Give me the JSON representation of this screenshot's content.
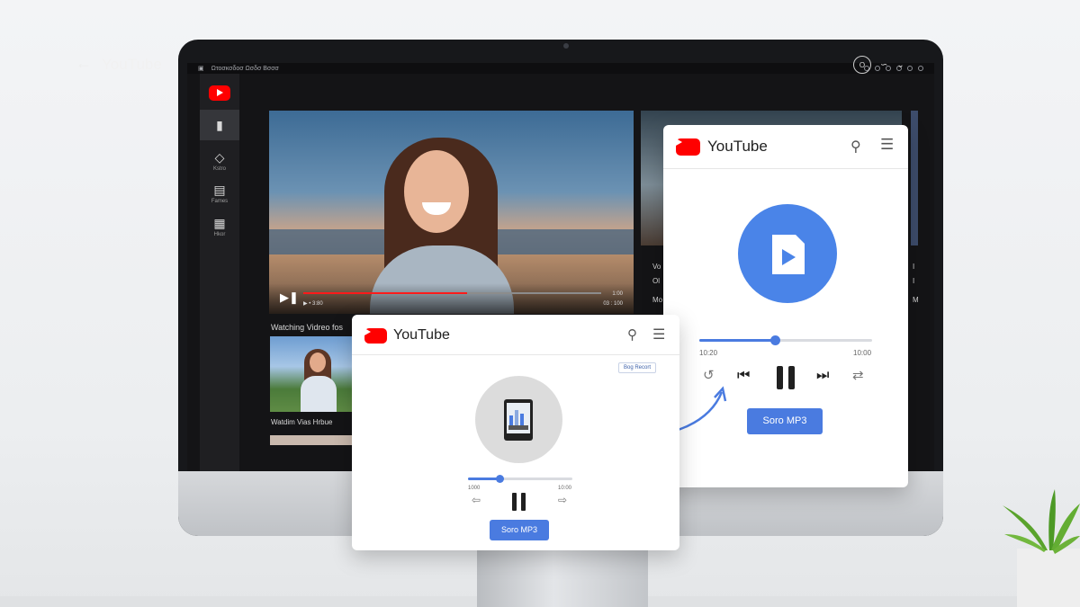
{
  "window": {
    "mac_bar_text": "Ωτοσκσδοσ Ωσδσ Βσσσ"
  },
  "sidebar": {
    "items": [
      {
        "icon": "youtube-logo-icon",
        "label": ""
      },
      {
        "icon": "file-icon",
        "label": ""
      },
      {
        "icon": "diamond-icon",
        "label": "Kstro"
      },
      {
        "icon": "clapper-icon",
        "label": "Fames"
      },
      {
        "icon": "music-file-icon",
        "label": "Hkor"
      }
    ]
  },
  "header": {
    "back_icon": "back-arrow-icon",
    "title": "YouTube",
    "account_text": "O"
  },
  "hero": {
    "time_left": "▶ • 3:80",
    "time_right_top": "1:00",
    "time_right_bottom": "03 : 100",
    "progress": 0.55
  },
  "side_column": {
    "labels": [
      "Vo",
      "Ol",
      "Mo"
    ]
  },
  "right_edge": {
    "labels": [
      "I",
      "I",
      "M"
    ]
  },
  "list": {
    "title": "Watching Vidreo fos",
    "caption": "Watdim Vias Hrbue"
  },
  "popup_small": {
    "brand": "YouTube",
    "badge": "Bog Recort",
    "progress": 0.3,
    "time_start": "1000",
    "time_end": "10:00",
    "button": "Soro MP3"
  },
  "popup_large": {
    "brand": "YouTube",
    "progress": 0.44,
    "time_start": "10:20",
    "time_end": "10:00",
    "button": "Soro MP3"
  },
  "colors": {
    "accent": "#4a7be0",
    "youtube_red": "#ff0000"
  }
}
